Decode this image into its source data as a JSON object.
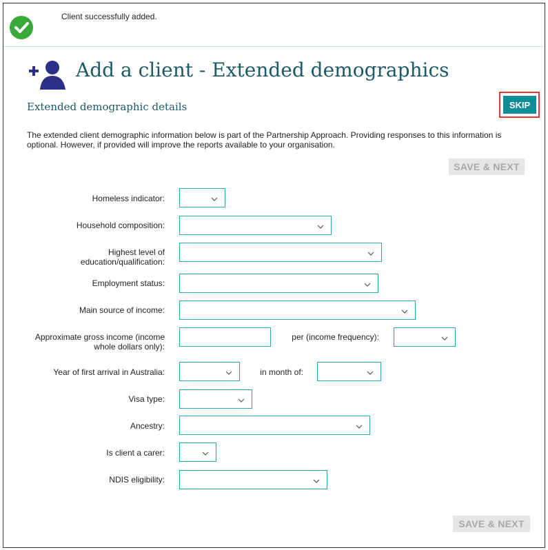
{
  "notice": {
    "message": "Client successfully added.",
    "icon": "check-circle-icon",
    "color": "#3aa83a"
  },
  "header": {
    "title": "Add a client - Extended demographics",
    "subtitle": "Extended demographic details",
    "skip_label": "SKIP",
    "icon": "add-person-icon",
    "color": "#1e5a66"
  },
  "intro": "The extended client demographic information below is part of the Partnership Approach.  Providing responses to this information is optional. However, if provided will improve the reports available to your organisation.",
  "save_label": "SAVE & NEXT",
  "fields": {
    "homeless": {
      "label": "Homeless indicator:",
      "value": ""
    },
    "household": {
      "label": "Household composition:",
      "value": ""
    },
    "education": {
      "label": "Highest level of education/qualification:",
      "value": ""
    },
    "employment": {
      "label": "Employment status:",
      "value": ""
    },
    "income_source": {
      "label": "Main source of income:",
      "value": ""
    },
    "gross_income": {
      "label": "Approximate gross income (income whole dollars only):",
      "value": ""
    },
    "income_frequency": {
      "label": "per (income frequency):",
      "value": ""
    },
    "arrival_year": {
      "label": "Year of first arrival in Australia:",
      "value": ""
    },
    "arrival_month": {
      "label": "in month of:",
      "value": ""
    },
    "visa": {
      "label": "Visa type:",
      "value": ""
    },
    "ancestry": {
      "label": "Ancestry:",
      "value": ""
    },
    "carer": {
      "label": "Is client a carer:",
      "value": ""
    },
    "ndis": {
      "label": "NDIS eligibility:",
      "value": ""
    }
  },
  "colors": {
    "accent": "#0f8c95",
    "border": "#2ea3ad",
    "highlight": "#e03838"
  }
}
